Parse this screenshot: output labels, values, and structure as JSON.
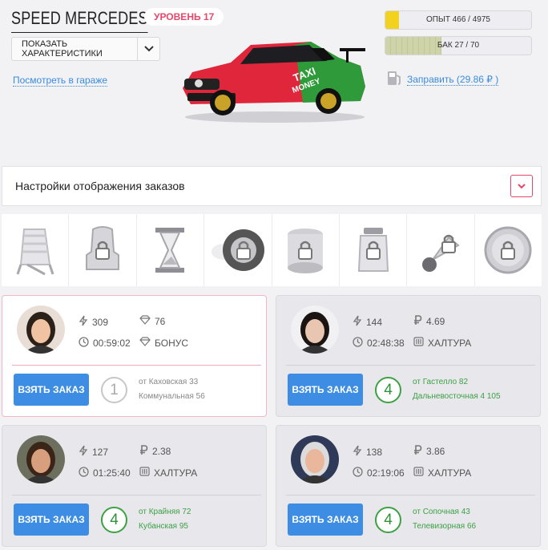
{
  "car": {
    "name": "SPEED MERCEDES",
    "level_label": "УРОВЕНЬ 17",
    "show_chars_label": "ПОКАЗАТЬ ХАРАКТЕРИСТИКИ",
    "garage_link": "Посмотреть в гараже",
    "image_icon": "racing-car-image"
  },
  "stats": {
    "xp_label": "ОПЫТ 466 / 4975",
    "xp_current": 466,
    "xp_max": 4975,
    "fuel_label": "БАК 27 / 70",
    "fuel_current": 27,
    "fuel_max": 70,
    "refuel_label": "Заправить (29.86 ₽ )"
  },
  "settings": {
    "label": "Настройки отображения заказов"
  },
  "upgrade_icons": [
    "beach-chair-icon",
    "car-seat-lock-icon",
    "hourglass-icon",
    "tire-lock-icon",
    "money-roll-lock-icon",
    "money-jar-lock-icon",
    "horn-lock-icon",
    "coin-lock-icon"
  ],
  "colors": {
    "accent_pink": "#e8476a",
    "button_blue": "#3c8de3",
    "rating_green": "#3da144",
    "xp_yellow": "#f2d21e"
  },
  "orders": [
    {
      "speed": "309",
      "reward_icon": "diamond-icon",
      "reward": "76",
      "time": "00:59:02",
      "type_icon": "diamond-icon",
      "type": "БОНУС",
      "button": "ВЗЯТЬ ЗАКАЗ",
      "rating": "1",
      "from": "от Каховская 33",
      "to": "Коммунальная 56"
    },
    {
      "speed": "144",
      "reward_icon": "ruble-icon",
      "reward": "4.69",
      "time": "02:48:38",
      "type_icon": "meter-icon",
      "type": "ХАЛТУРА",
      "button": "ВЗЯТЬ ЗАКАЗ",
      "rating": "4",
      "from": "от Гастелло 82",
      "to": "Дальневосточная 4 105"
    },
    {
      "speed": "127",
      "reward_icon": "ruble-icon",
      "reward": "2.38",
      "time": "01:25:40",
      "type_icon": "meter-icon",
      "type": "ХАЛТУРА",
      "button": "ВЗЯТЬ ЗАКАЗ",
      "rating": "4",
      "from": "от Крайняя 72",
      "to": "Кубанская 95"
    },
    {
      "speed": "138",
      "reward_icon": "ruble-icon",
      "reward": "3.86",
      "time": "02:19:06",
      "type_icon": "meter-icon",
      "type": "ХАЛТУРА",
      "button": "ВЗЯТЬ ЗАКАЗ",
      "rating": "4",
      "from": "от Сопочная 43",
      "to": "Телевизорная 66"
    }
  ]
}
